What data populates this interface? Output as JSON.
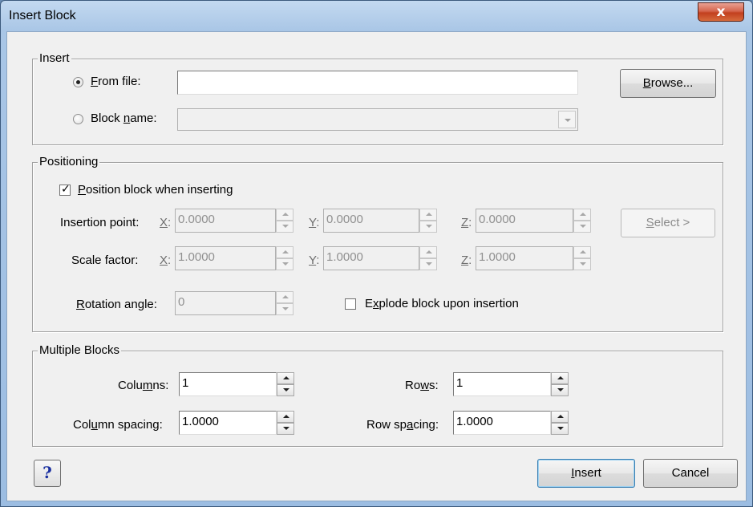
{
  "window": {
    "title": "Insert Block",
    "close_glyph": "x"
  },
  "insert_group": {
    "label": "Insert",
    "from_file": {
      "prefix": "",
      "accel": "F",
      "suffix": "rom file:",
      "selected": true,
      "value": ""
    },
    "block_name": {
      "prefix": "Block ",
      "accel": "n",
      "suffix": "ame:",
      "selected": false,
      "value": ""
    },
    "browse": {
      "prefix": "",
      "accel": "B",
      "suffix": "rowse..."
    }
  },
  "positioning_group": {
    "label": "Positioning",
    "position_when_inserting": {
      "prefix": "",
      "accel": "P",
      "suffix": "osition block when inserting",
      "checked": true
    },
    "insertion_point": {
      "label": "Insertion point:",
      "x_label": "X",
      "y_label": "Y",
      "z_label": "Z",
      "colon": ":",
      "x": "0.0000",
      "y": "0.0000",
      "z": "0.0000"
    },
    "scale_factor": {
      "label": "Scale factor:",
      "x_label": "X",
      "y_label": "Y",
      "z_label": "Z",
      "colon": ":",
      "x": "1.0000",
      "y": "1.0000",
      "z": "1.0000"
    },
    "rotation_angle": {
      "accel": "R",
      "suffix": "otation angle:",
      "value": "0"
    },
    "explode": {
      "prefix": "E",
      "accel": "x",
      "suffix": "plode block upon insertion",
      "checked": false
    },
    "select_button": {
      "accel": "S",
      "suffix": "elect >"
    }
  },
  "multiple_blocks_group": {
    "label": "Multiple Blocks",
    "columns": {
      "prefix": "Colu",
      "accel": "m",
      "suffix": "ns:",
      "value": "1"
    },
    "rows": {
      "prefix": "Ro",
      "accel": "w",
      "suffix": "s:",
      "value": "1"
    },
    "column_spacing": {
      "prefix": "Col",
      "accel": "u",
      "suffix": "mn spacing:",
      "value": "1.0000"
    },
    "row_spacing": {
      "prefix": "Row sp",
      "accel": "a",
      "suffix": "cing:",
      "value": "1.0000"
    }
  },
  "footer": {
    "help_glyph": "?",
    "insert_button": {
      "accel": "I",
      "suffix": "nsert"
    },
    "cancel_button": "Cancel"
  }
}
